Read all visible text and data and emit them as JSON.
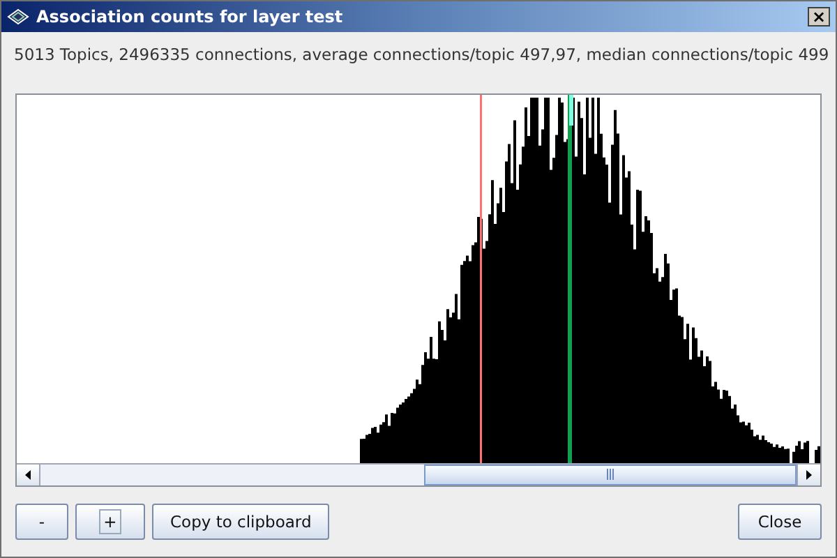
{
  "window": {
    "title": "Association counts for layer test",
    "close_label": "×"
  },
  "summary": "5013 Topics, 2496335 connections, average connections/topic 497,97, median connections/topic 499",
  "buttons": [
    {
      "label": "-",
      "focused": false
    },
    {
      "label": "+",
      "focused": true
    },
    {
      "label": "Copy to clipboard",
      "focused": false
    }
  ],
  "close_button": "Close"
}
